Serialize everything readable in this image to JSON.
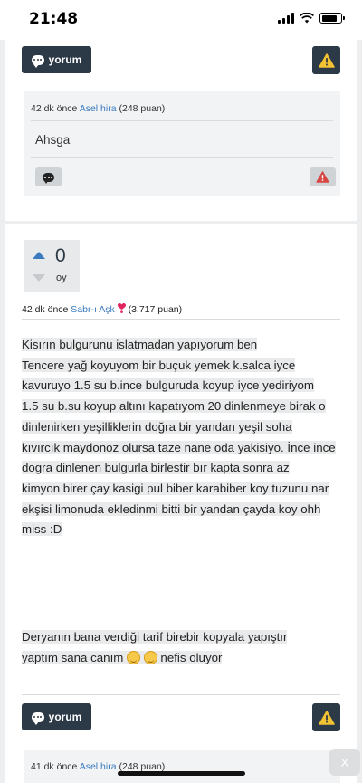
{
  "status_bar": {
    "time": "21:48"
  },
  "top_card": {
    "yorum_label": "yorum",
    "comment": {
      "time_ago": "42 dk önce",
      "user": "Asel hira",
      "points": "(248 puan)",
      "text": "Ahsga"
    }
  },
  "post": {
    "vote_count": "0",
    "vote_label": "oy",
    "time_ago": "42 dk önce",
    "user": "Sabr-ı Aşk",
    "points": "(3,717 puan)",
    "body_lines": [
      "Kisırın bulgurunu islatmadan yapıyorum ben",
      "Tencere yağ koyuyom bir buçuk yemek k.salca iyce",
      "kavuruyo 1.5 su b.ince bulguruda koyup iyce yediriyom",
      "1.5 su b.su koyup altını kapatıyom 20 dinlenmeye birak o",
      "dinlenirken yeşilliklerin doğra bir yandan yeşil soha",
      "kıvırcık maydonoz olursa taze nane oda yakisiyo. İnce ince",
      "dogra dinlenen bulgurla birlestir bır kapta sonra az",
      "kimyon birer çay kasigi pul biber karabiber koy tuzunu nar",
      "ekşisi limonuda ekledinmi bitti bir yandan çayda koy ohh",
      "miss :D"
    ],
    "extra_line1": " Deryanın bana verdiği tarif birebir kopyala yapıştır",
    "extra_line2_before": "yaptım sana canım ",
    "extra_line2_after": " nefis oluyor ",
    "yorum_label": "yorum"
  },
  "bottom_comment": {
    "time_ago": "41 dk önce",
    "user": "Asel hira",
    "points": "(248 puan)"
  },
  "close_label": "X"
}
